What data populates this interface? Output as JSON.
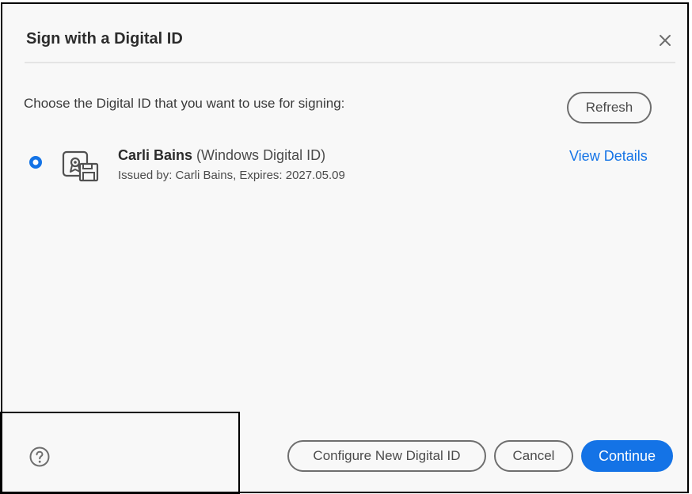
{
  "dialog": {
    "title": "Sign with a Digital ID",
    "close_icon": "close-icon"
  },
  "instruction": "Choose the Digital ID that you want to use for signing:",
  "refresh_label": "Refresh",
  "digital_id": {
    "selected": true,
    "icon": "certificate-icon",
    "name": "Carli Bains",
    "type": " (Windows Digital ID)",
    "issued": "Issued by: Carli Bains, Expires: 2027.05.09",
    "view_details_label": "View Details"
  },
  "footer": {
    "help_icon": "help-icon",
    "configure_label": "Configure New Digital ID",
    "cancel_label": "Cancel",
    "continue_label": "Continue"
  },
  "colors": {
    "accent": "#1473e6",
    "dialog_background": "#f8f8f8",
    "text": "#2c2c2c"
  }
}
